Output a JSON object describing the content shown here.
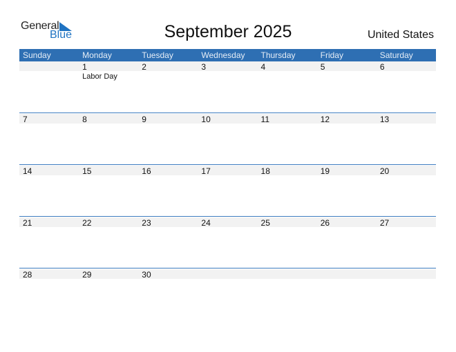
{
  "logo": {
    "word1": "General",
    "word2": "Blue"
  },
  "title": "September 2025",
  "country": "United States",
  "colors": {
    "header_bg": "#2e6fb3",
    "accent": "#1f73c2",
    "date_band": "#f2f2f2"
  },
  "weekdays": [
    "Sunday",
    "Monday",
    "Tuesday",
    "Wednesday",
    "Thursday",
    "Friday",
    "Saturday"
  ],
  "weeks": [
    [
      {
        "day": ""
      },
      {
        "day": "1",
        "holiday": "Labor Day"
      },
      {
        "day": "2"
      },
      {
        "day": "3"
      },
      {
        "day": "4"
      },
      {
        "day": "5"
      },
      {
        "day": "6"
      }
    ],
    [
      {
        "day": "7"
      },
      {
        "day": "8"
      },
      {
        "day": "9"
      },
      {
        "day": "10"
      },
      {
        "day": "11"
      },
      {
        "day": "12"
      },
      {
        "day": "13"
      }
    ],
    [
      {
        "day": "14"
      },
      {
        "day": "15"
      },
      {
        "day": "16"
      },
      {
        "day": "17"
      },
      {
        "day": "18"
      },
      {
        "day": "19"
      },
      {
        "day": "20"
      }
    ],
    [
      {
        "day": "21"
      },
      {
        "day": "22"
      },
      {
        "day": "23"
      },
      {
        "day": "24"
      },
      {
        "day": "25"
      },
      {
        "day": "26"
      },
      {
        "day": "27"
      }
    ],
    [
      {
        "day": "28"
      },
      {
        "day": "29"
      },
      {
        "day": "30"
      },
      {
        "day": ""
      },
      {
        "day": ""
      },
      {
        "day": ""
      },
      {
        "day": ""
      }
    ]
  ]
}
